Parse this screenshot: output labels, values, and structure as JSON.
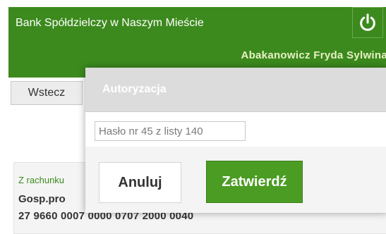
{
  "header": {
    "bank_name": "Bank Spółdzielczy w Naszym Mieście",
    "user_name": "Abakanowicz Fryda Sylwina",
    "power_icon": "power-icon"
  },
  "toolbar": {
    "back_label": "Wstecz"
  },
  "account": {
    "from_label": "Z rachunku",
    "name": "Gosp.pro",
    "number": "27 9660 0007 0000 0707 2000 0040"
  },
  "modal": {
    "title": "Autoryzacja",
    "password_placeholder": "Hasło nr 45 z listy 140",
    "password_value": "",
    "cancel_label": "Anuluj",
    "confirm_label": "Zatwierdź"
  },
  "colors": {
    "brand_green": "#3c8a1e",
    "confirm_green": "#4a9c22"
  }
}
